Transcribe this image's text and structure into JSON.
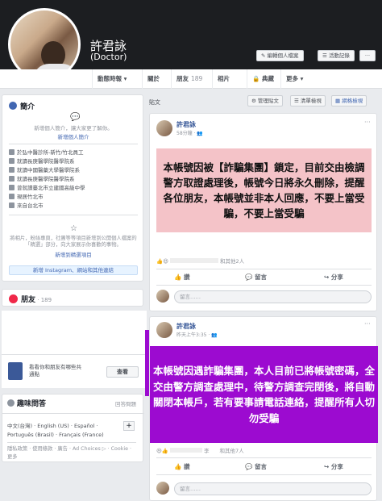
{
  "profile": {
    "name": "許君詠",
    "title": "(Doctor)",
    "edit_button": "編輯個人檔案",
    "activity_button": "活動記錄",
    "more": "···"
  },
  "nav": {
    "tabs": [
      {
        "label": "動態時報",
        "suffix": "▾"
      },
      {
        "label": "關於"
      },
      {
        "label": "朋友",
        "count": "189"
      },
      {
        "label": "相片"
      },
      {
        "label": "典藏",
        "icon": "lock-icon"
      },
      {
        "label": "更多",
        "suffix": "▾"
      }
    ]
  },
  "intro": {
    "heading": "簡介",
    "bio_prompt": "新增個人簡介，讓大家更了解你。",
    "add_bio": "新增個人簡介",
    "items": [
      "於弘中醫診所-新竹/竹北員工",
      "就讀長庚醫學院醫學院系",
      "就讀中國醫藥大學醫學院系",
      "就讀長庚醫學院醫學院系",
      "曾就讀臺北市立建國高級中學",
      "現居竹北市",
      "來自台北市"
    ],
    "featured_text": "將相片，粉絲專頁，社團等等項目新增到公開個人檔案的「精選」部分，向大家展示你喜歡的事物。",
    "add_featured": "新增到精選項目",
    "instagram_button": "新增 Instagram、網站和其他連結"
  },
  "friends": {
    "heading": "朋友",
    "count": "· 189"
  },
  "suggest": {
    "text": "看看你和朋友有哪些共通點",
    "button": "查看"
  },
  "interests": {
    "heading": "趣味問答",
    "button": "回答問題"
  },
  "lang": {
    "langs": "中文(台灣) · English (US) · Español · Português (Brasil) · Français (France)",
    "plus": "+",
    "footer": "隱私政策 · 使用條款 · 廣告 · Ad Choices ▷ · Cookie · 更多"
  },
  "feed": {
    "label": "貼文",
    "manage_button": "管理貼文",
    "list_view": "清單檢視",
    "grid_view": "網格檢視"
  },
  "post1": {
    "author": "許君詠",
    "time": "58分鐘 · ",
    "text": "本帳號因被【詐騙集團】鎖定，目前交由檢調警方取證處理後，帳號今日將永久刪除，提醒各位朋友，本帳號並非本人回應，不要上當受騙，不要上當受騙",
    "reactions": "和其他2人",
    "like": "讚",
    "comment": "留言",
    "share": "分享",
    "comment_placeholder": "留言……"
  },
  "post2": {
    "author": "許君詠",
    "time": "昨天上午3:35 · ",
    "text": "本帳號因遇詐騙集團，本人目前已將帳號密碼，全交由警方調查處理中，待警方調查完閉後，將自動關閉本帳戶，若有要事請電話連絡，提醒所有人切勿受騙",
    "reactions": "李　　和其他7人",
    "like": "讚",
    "comment": "留言",
    "share": "分享",
    "comment_placeholder": "留言……"
  },
  "colors": {
    "cover": "#1c1e21",
    "pink": "#f4c3c8",
    "purple": "#9c0bd0",
    "link": "#385898"
  }
}
